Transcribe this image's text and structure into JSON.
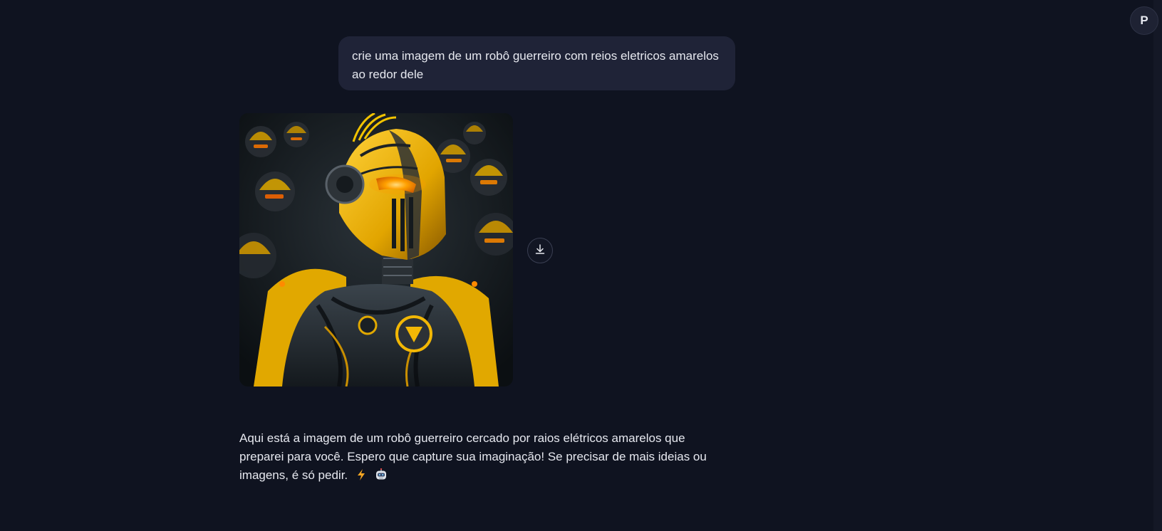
{
  "user_avatar": {
    "initial": "P"
  },
  "user_message": {
    "text": "crie uma imagem de um robô guerreiro com reios eletricos amarelos ao redor dele"
  },
  "generated_image": {
    "subject": "yellow and black armored warrior robot with glowing orange visor, surrounded by rows of similar robots"
  },
  "download_button": {
    "icon": "download-icon"
  },
  "assistant_message": {
    "text": "Aqui está a imagem de um robô guerreiro cercado por raios elétricos amarelos que preparei para você. Espero que capture sua imaginação! Se precisar de mais ideias ou imagens, é só pedir.",
    "emojis": [
      "lightning-emoji",
      "robot-emoji"
    ]
  },
  "colors": {
    "background": "#0f1320",
    "user_bubble": "#1f2337",
    "text": "#e6e8ef",
    "robot_yellow": "#f2b705",
    "visor_orange": "#ff8a00"
  }
}
